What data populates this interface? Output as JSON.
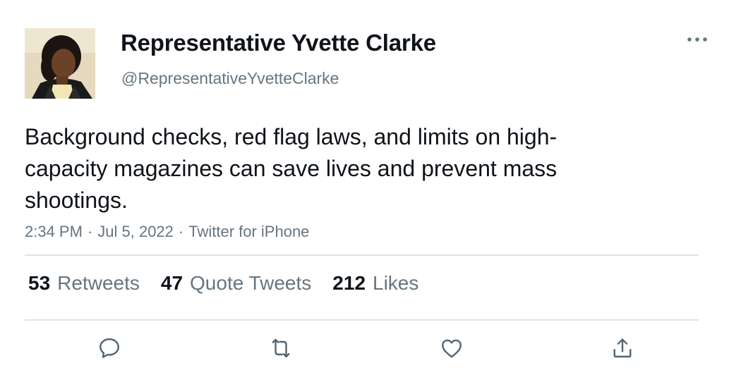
{
  "author": {
    "display_name": "Representative Yvette Clarke",
    "handle": "@RepresentativeYvetteClarke",
    "avatar_icon": "profile-photo"
  },
  "tweet": {
    "text": "Background checks, red flag laws, and limits on high-\ncapacity magazines can save lives and prevent mass\nshootings.",
    "time": "2:34 PM",
    "date": "Jul 5, 2022",
    "source": "Twitter for iPhone",
    "separator": "·"
  },
  "stats": {
    "retweets": {
      "count": "53",
      "label": "Retweets"
    },
    "quotes": {
      "count": "47",
      "label": "Quote Tweets"
    },
    "likes": {
      "count": "212",
      "label": "Likes"
    }
  },
  "actions": [
    {
      "name": "reply",
      "icon": "speech-bubble-icon"
    },
    {
      "name": "retweet",
      "icon": "retweet-arrows-icon"
    },
    {
      "name": "like",
      "icon": "heart-icon"
    },
    {
      "name": "share",
      "icon": "share-upload-icon"
    }
  ],
  "colors": {
    "text_primary": "#0f1419",
    "text_secondary": "#66757f",
    "divider": "#dfe3e6",
    "icon": "#536471"
  }
}
